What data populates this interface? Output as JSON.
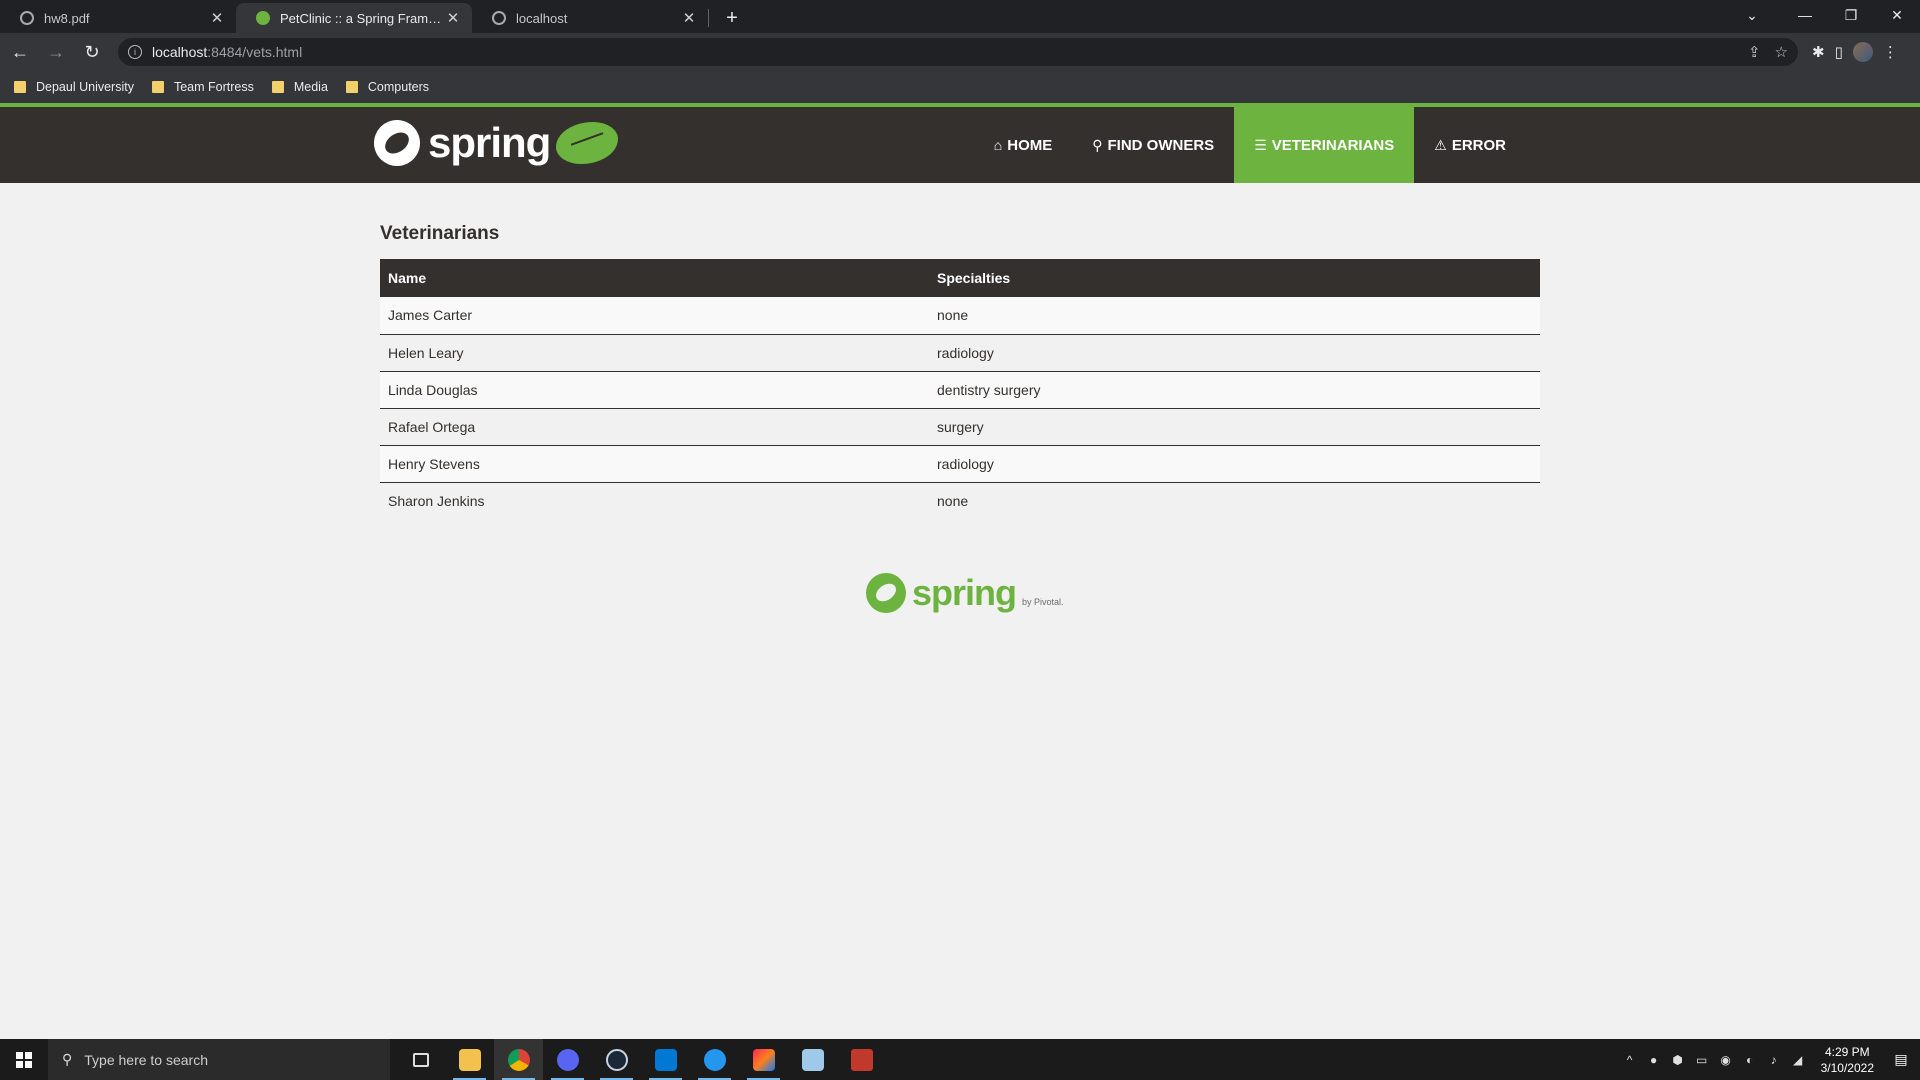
{
  "browser": {
    "tabs": [
      {
        "title": "hw8.pdf",
        "icon": "globe-icon",
        "active": false
      },
      {
        "title": "PetClinic :: a Spring Framework demonstration",
        "icon": "spring-leaf-icon",
        "active": true
      },
      {
        "title": "localhost",
        "icon": "globe-icon",
        "active": false
      }
    ],
    "url_host": "localhost",
    "url_path": ":8484/vets.html",
    "bookmarks": [
      "Depaul University",
      "Team Fortress",
      "Media",
      "Computers"
    ]
  },
  "site": {
    "logo_text": "spring",
    "nav": [
      {
        "label": "Home",
        "icon": "home-icon",
        "active": false
      },
      {
        "label": "Find owners",
        "icon": "search-icon",
        "active": false
      },
      {
        "label": "Veterinarians",
        "icon": "list-icon",
        "active": true
      },
      {
        "label": "Error",
        "icon": "warning-icon",
        "active": false
      }
    ],
    "accent_color": "#6db33f",
    "navbar_color": "#34302d"
  },
  "main": {
    "heading": "Veterinarians",
    "table": {
      "headers": [
        "Name",
        "Specialties"
      ],
      "rows": [
        [
          "James Carter",
          "none"
        ],
        [
          "Helen Leary",
          "radiology"
        ],
        [
          "Linda Douglas",
          "dentistry surgery"
        ],
        [
          "Rafael Ortega",
          "surgery"
        ],
        [
          "Henry Stevens",
          "radiology"
        ],
        [
          "Sharon Jenkins",
          "none"
        ]
      ]
    }
  },
  "footer": {
    "logo_text": "spring",
    "by_text": "by Pivotal."
  },
  "taskbar": {
    "search_placeholder": "Type here to search",
    "time": "4:29 PM",
    "date": "3/10/2022"
  }
}
